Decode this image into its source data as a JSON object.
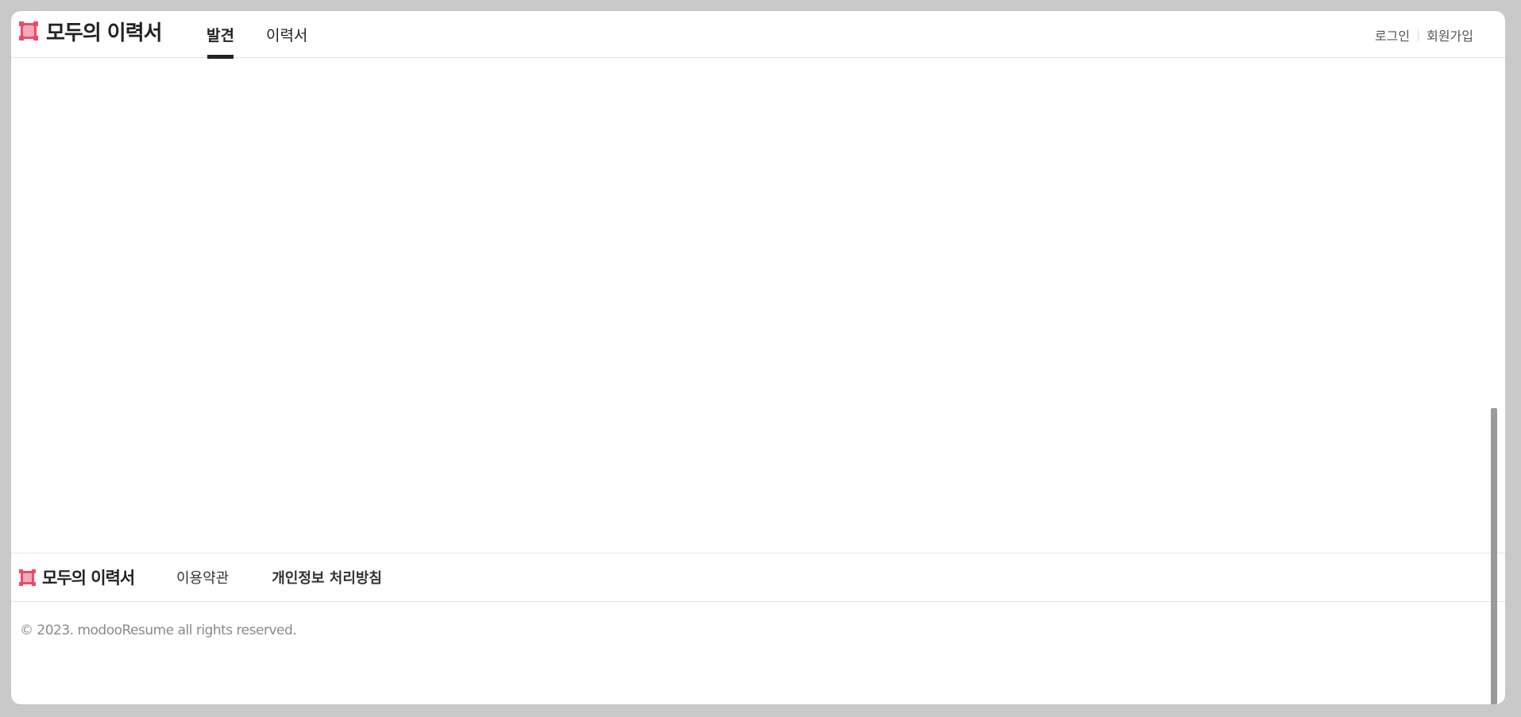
{
  "header": {
    "logo_text": "모두의 이력서",
    "nav": [
      {
        "label": "발견",
        "active": true
      },
      {
        "label": "이력서",
        "active": false
      }
    ],
    "auth": {
      "login": "로그인",
      "signup": "회원가입"
    }
  },
  "footer": {
    "logo_text": "모두의 이력서",
    "links": {
      "terms": "이용약관",
      "privacy": "개인정보 처리방침"
    },
    "copyright": "© 2023. modooResume all rights reserved."
  },
  "colors": {
    "brand": "#ee4a6a",
    "text": "#222222",
    "muted": "#8a8a8a",
    "background": "#c9c9c9"
  }
}
